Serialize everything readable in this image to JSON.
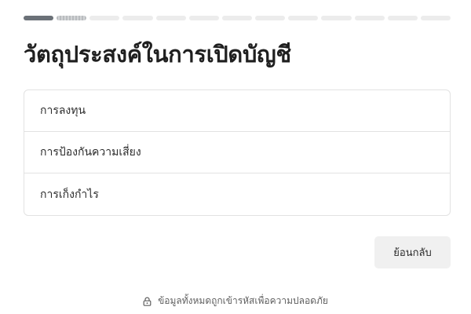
{
  "progress": {
    "total_steps": 13,
    "completed_steps": 1,
    "current_step": 2
  },
  "page": {
    "title": "วัตถุประสงค์ในการเปิดบัญชี"
  },
  "options": [
    {
      "label": "การลงทุน"
    },
    {
      "label": "การป้องกันความเสี่ยง"
    },
    {
      "label": "การเก็งกำไร"
    }
  ],
  "actions": {
    "back_label": "ย้อนกลับ"
  },
  "footer": {
    "icon": "lock-icon",
    "note": "ข้อมูลทั้งหมดถูกเข้ารหัสเพื่อความปลอดภัย"
  },
  "colors": {
    "progress_done": "#6b7178",
    "progress_current": "#c4c6c8",
    "progress_todo": "#ececec",
    "border": "#e2e2e2",
    "button_bg": "#f0f0f0"
  }
}
